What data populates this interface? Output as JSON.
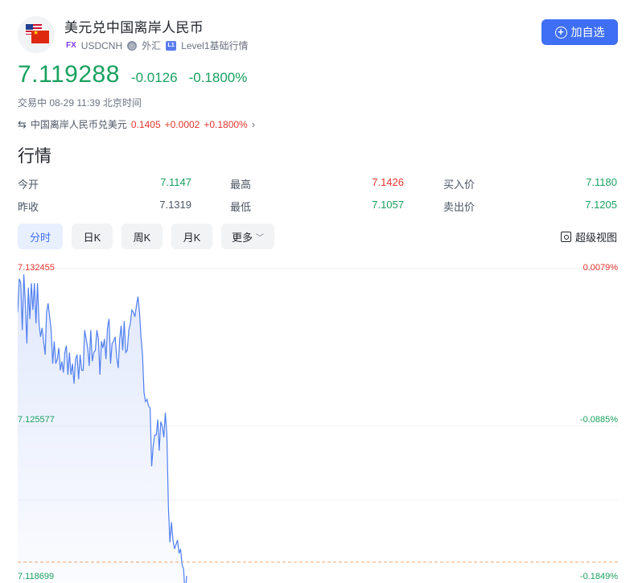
{
  "header": {
    "name": "美元兑中国离岸人民币",
    "fx_badge": "FX",
    "symbol": "USDCNH",
    "category": "外汇",
    "level": "Level1基础行情",
    "add_button": "加自选"
  },
  "quote": {
    "price": "7.119288",
    "change": "-0.0126",
    "change_pct": "-0.1800%",
    "status": "交易中 08-29 11:39 北京时间",
    "reverse_pair": "中国离岸人民币兑美元",
    "reverse_price": "0.1405",
    "reverse_change": "+0.0002",
    "reverse_change_pct": "+0.1800%"
  },
  "section_title": "行情",
  "stats": {
    "open_label": "今开",
    "open": "7.1147",
    "high_label": "最高",
    "high": "7.1426",
    "bid_label": "买入价",
    "bid": "7.1180",
    "prev_close_label": "昨收",
    "prev_close": "7.1319",
    "low_label": "最低",
    "low": "7.1057",
    "ask_label": "卖出价",
    "ask": "7.1205"
  },
  "tabs": [
    "分时",
    "日K",
    "周K",
    "月K",
    "更多"
  ],
  "active_tab": "分时",
  "fullscreen_label": "超级视图",
  "colors": {
    "up": "#e5342d",
    "down": "#19a15f",
    "accent": "#3f6ff5",
    "line": "#4f7ff0"
  },
  "chart_data": {
    "type": "area",
    "y_labels_left": [
      "7.132455",
      "7.125577",
      "7.118699"
    ],
    "y_labels_right": [
      "0.0079%",
      "-0.0885%",
      "-0.1849%"
    ],
    "ylim": [
      7.118699,
      7.132455
    ],
    "reference_value": 7.118699,
    "values": [
      7.1305,
      7.132,
      7.1318,
      7.1297,
      7.1322,
      7.1309,
      7.1291,
      7.1316,
      7.1302,
      7.1318,
      7.1306,
      7.1318,
      7.13,
      7.1318,
      7.13,
      7.1294,
      7.1298,
      7.1292,
      7.1286,
      7.1305,
      7.1309,
      7.1303,
      7.1297,
      7.1282,
      7.1292,
      7.1282,
      7.1284,
      7.1289,
      7.1279,
      7.1283,
      7.1278,
      7.1287,
      7.129,
      7.1277,
      7.1287,
      7.1277,
      7.1282,
      7.1273,
      7.1284,
      7.1286,
      7.1275,
      7.1286,
      7.1279,
      7.1279,
      7.1297,
      7.1293,
      7.1289,
      7.1281,
      7.1297,
      7.1283,
      7.1287,
      7.1288,
      7.1297,
      7.1293,
      7.1277,
      7.1292,
      7.1289,
      7.1293,
      7.1284,
      7.1298,
      7.1302,
      7.1282,
      7.1291,
      7.1292,
      7.1294,
      7.1285,
      7.128,
      7.1293,
      7.1299,
      7.1288,
      7.1301,
      7.1287,
      7.1288,
      7.1297,
      7.13,
      7.1306,
      7.1305,
      7.1303,
      7.1308,
      7.1312,
      7.1305,
      7.1294,
      7.1286,
      7.1269,
      7.1265,
      7.1266,
      7.1263,
      7.1262,
      7.1236,
      7.1245,
      7.125,
      7.125,
      7.1257,
      7.1243,
      7.1256,
      7.1254,
      7.1249,
      7.126,
      7.125,
      7.1218,
      7.1202,
      7.1211,
      7.1203,
      7.1199,
      7.1201,
      7.1203,
      7.1197,
      7.1199,
      7.1192,
      7.119,
      7.1178,
      7.1187
    ]
  }
}
